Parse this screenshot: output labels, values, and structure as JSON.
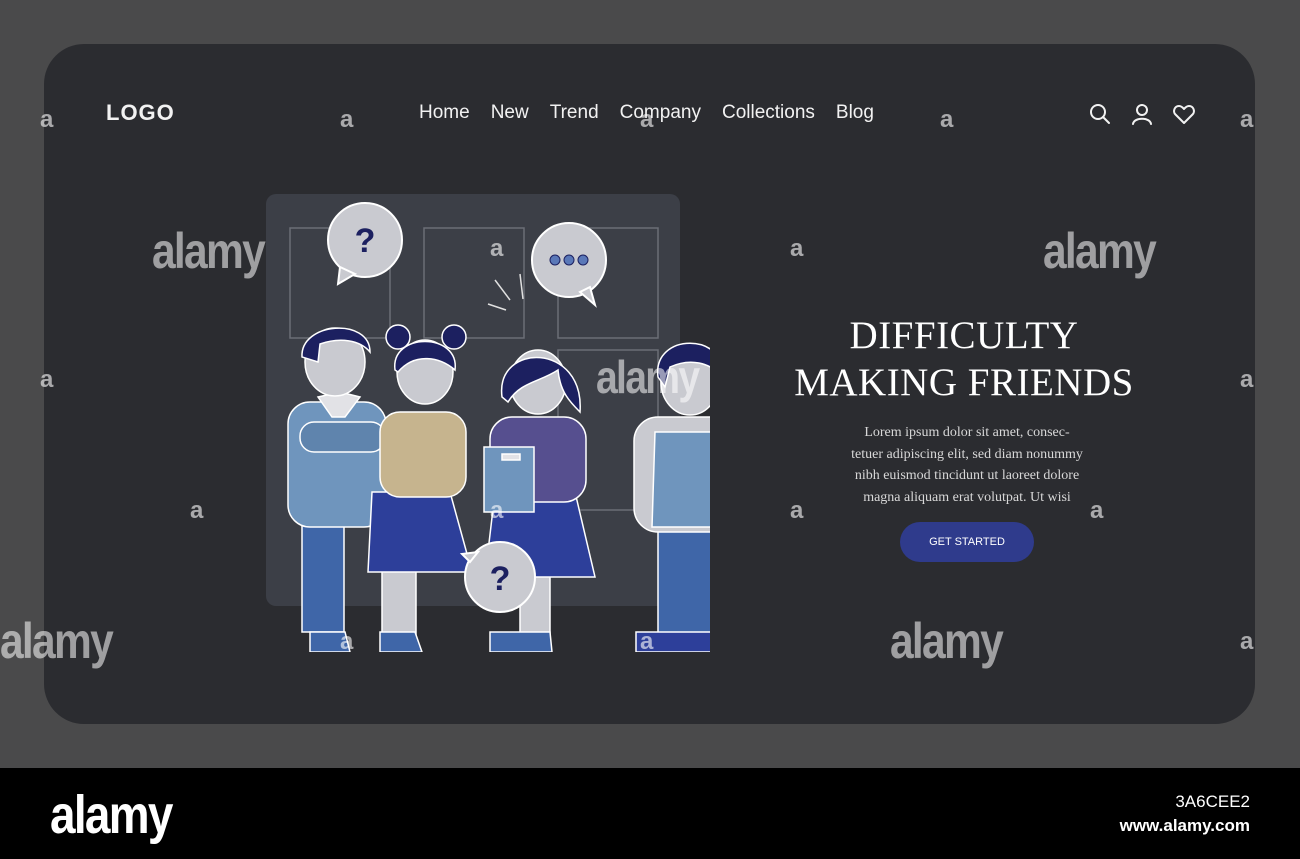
{
  "header": {
    "logo": "LOGO",
    "nav": [
      "Home",
      "New",
      "Trend",
      "Company",
      "Collections",
      "Blog"
    ],
    "icons": [
      "search-icon",
      "user-icon",
      "heart-icon"
    ]
  },
  "hero": {
    "title_lines": [
      "DIFFICULTY",
      "MAKING FRIENDS"
    ],
    "body_lines": [
      "Lorem ipsum dolor sit amet, consec-",
      "tetuer adipiscing elit, sed diam nonummy",
      "nibh euismod tincidunt ut laoreet dolore",
      "magna aliquam erat volutpat. Ut wisi"
    ],
    "cta_label": "GET STARTED",
    "bubble_question": "?"
  },
  "watermark": {
    "brand": "alamy",
    "small": "a"
  },
  "footer": {
    "brand": "alamy",
    "image_id": "3A6CEE2",
    "url": "www.alamy.com"
  },
  "colors": {
    "page_bg": "#4a4a4b",
    "card_bg": "#2b2c30",
    "accent": "#2f3b8c",
    "text": "#ffffff"
  }
}
